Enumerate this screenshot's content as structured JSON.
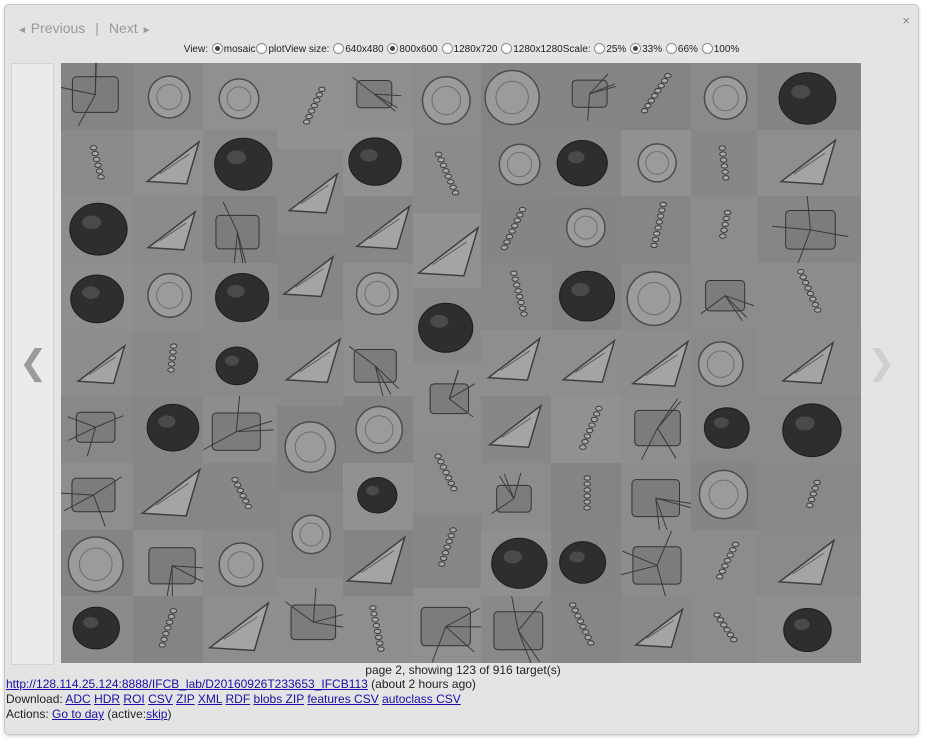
{
  "dialog": {
    "close_glyph": "×"
  },
  "nav": {
    "previous_label": "Previous",
    "next_label": "Next",
    "separator": "|",
    "prev_glyph": "◄",
    "next_glyph": "►"
  },
  "options": {
    "view_label": "View:",
    "view_mosaic": "mosaic",
    "view_plot": "plot",
    "size_label": "View size:",
    "size_640": "640x480",
    "size_800": "800x600",
    "size_1280x720": "1280x720",
    "size_1280x1280": "1280x1280",
    "scale_label": "Scale:",
    "scale_25": "25%",
    "scale_33": "33%",
    "scale_66": "66%",
    "scale_100": "100%",
    "selected_view": "mosaic",
    "selected_size": "800x600",
    "selected_scale": "33%"
  },
  "mosaic": {
    "caption": "page 2, showing 123 of 916 target(s)",
    "page": 2,
    "shown": 123,
    "total": 916
  },
  "info": {
    "bin_url": "http://128.114.25.124:8888/IFCB_lab/D20160926T233653_IFCB113",
    "bin_age": "(about 2 hours ago)",
    "download_label": "Download:",
    "downloads": [
      "ADC",
      "HDR",
      "ROI",
      "CSV",
      "ZIP",
      "XML",
      "RDF",
      "blobs ZIP",
      "features CSV",
      "autoclass CSV"
    ],
    "actions_label": "Actions:",
    "go_to_day": "Go to day",
    "active_prefix": "(active:",
    "skip": "skip",
    "active_suffix": ")"
  },
  "colors": {
    "panel_bg": "#e4e4e4",
    "mosaic_bg": "#8c8c8c",
    "link": "#1a0dab",
    "nav_disabled": "#9a9a9a"
  },
  "icons": {
    "close": "close-icon",
    "prev_page": "chevron-left-icon",
    "next_page": "chevron-right-icon"
  }
}
